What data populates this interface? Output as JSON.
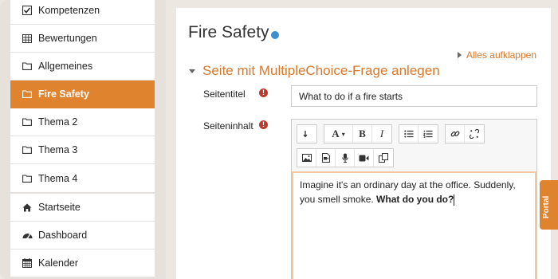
{
  "sidebar": {
    "items": [
      {
        "label": "Kompetenzen",
        "icon": "check-square-icon"
      },
      {
        "label": "Bewertungen",
        "icon": "table-icon"
      },
      {
        "label": "Allgemeines",
        "icon": "folder-icon"
      },
      {
        "label": "Fire Safety",
        "icon": "folder-icon",
        "active": true
      },
      {
        "label": "Thema 2",
        "icon": "folder-icon"
      },
      {
        "label": "Thema 3",
        "icon": "folder-icon"
      },
      {
        "label": "Thema 4",
        "icon": "folder-icon"
      }
    ],
    "items2": [
      {
        "label": "Startseite",
        "icon": "home-icon"
      },
      {
        "label": "Dashboard",
        "icon": "dashboard-icon"
      },
      {
        "label": "Kalender",
        "icon": "calendar-icon"
      }
    ]
  },
  "page": {
    "title": "Fire Safety",
    "expand_all": "Alles aufklappen",
    "section_title": "Seite mit MultipleChoice-Frage anlegen"
  },
  "form": {
    "title_label": "Seitentitel",
    "title_value": "What to do if a fire starts",
    "content_label": "Seiteninhalt",
    "content_text": "Imagine it's an ordinary day at the office. Suddenly, you smell smoke. ",
    "content_bold": "What do you do?"
  },
  "portal_tab": "Portal",
  "colors": {
    "accent": "#e0832f",
    "required": "#c0392b",
    "help": "#3d8fcf"
  }
}
